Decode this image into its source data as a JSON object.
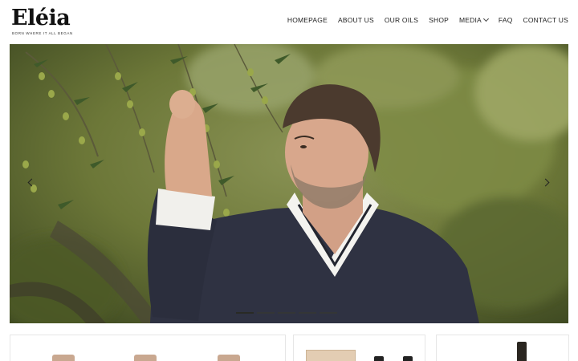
{
  "brand": {
    "name": "Eléia",
    "tagline": "BORN WHERE IT ALL BEGAN"
  },
  "nav": {
    "items": [
      {
        "label": "HOMEPAGE"
      },
      {
        "label": "ABOUT US"
      },
      {
        "label": "OUR OILS"
      },
      {
        "label": "SHOP"
      },
      {
        "label": "MEDIA",
        "has_dropdown": true
      },
      {
        "label": "FAQ"
      },
      {
        "label": "CONTACT US"
      }
    ]
  },
  "hero": {
    "slide_count": 5,
    "active_slide": 1,
    "icons": {
      "prev": "chevron-left-icon",
      "next": "chevron-right-icon"
    }
  },
  "colors": {
    "olive_background": "#6f7a3c",
    "sweater": "#2e3140",
    "cap_copper": "#c9a890"
  }
}
